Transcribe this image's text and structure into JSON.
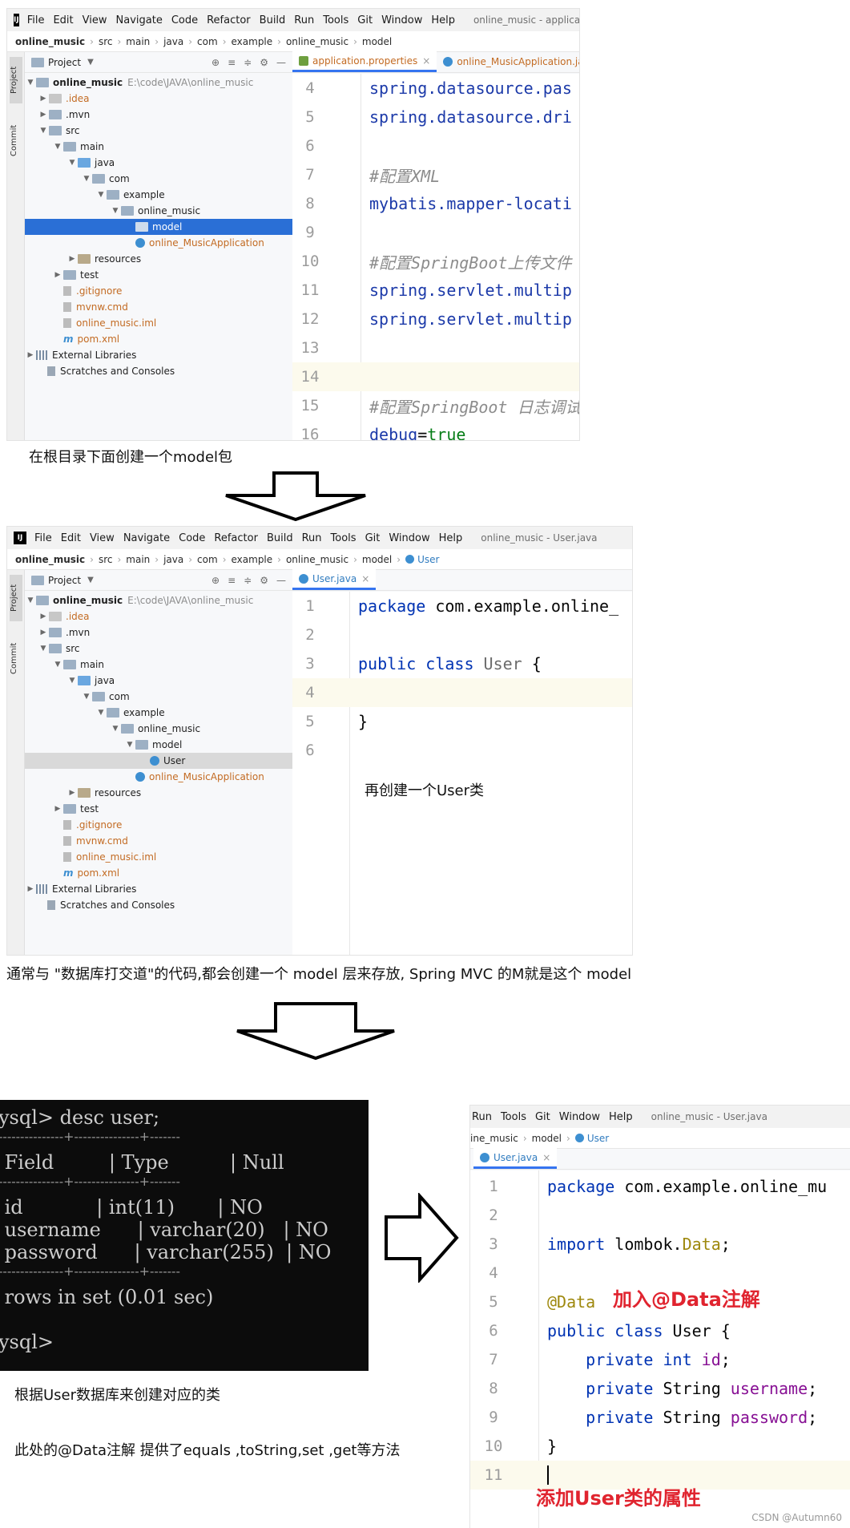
{
  "ide1": {
    "menu": [
      "File",
      "Edit",
      "View",
      "Navigate",
      "Code",
      "Refactor",
      "Build",
      "Run",
      "Tools",
      "Git",
      "Window",
      "Help"
    ],
    "window_title": "online_music - application",
    "breadcrumbs": [
      "online_music",
      "src",
      "main",
      "java",
      "com",
      "example",
      "online_music",
      "model"
    ],
    "side_tabs": [
      "Project",
      "Commit"
    ],
    "project_label": "Project",
    "tree": [
      {
        "label": "online_music",
        "extra": "E:\\code\\JAVA\\online_music"
      },
      {
        "label": ".idea"
      },
      {
        "label": ".mvn"
      },
      {
        "label": "src"
      },
      {
        "label": "main"
      },
      {
        "label": "java"
      },
      {
        "label": "com"
      },
      {
        "label": "example"
      },
      {
        "label": "online_music"
      },
      {
        "label": "model"
      },
      {
        "label": "online_MusicApplication"
      },
      {
        "label": "resources"
      },
      {
        "label": "test"
      },
      {
        "label": ".gitignore"
      },
      {
        "label": "mvnw.cmd"
      },
      {
        "label": "online_music.iml"
      },
      {
        "label": "pom.xml"
      },
      {
        "label": "External Libraries"
      },
      {
        "label": "Scratches and Consoles"
      }
    ],
    "tabs": [
      "application.properties",
      "online_MusicApplication.java"
    ],
    "lines": [
      {
        "n": "4",
        "code": "spring.datasource.pas"
      },
      {
        "n": "5",
        "code": "spring.datasource.dri"
      },
      {
        "n": "6",
        "code": ""
      },
      {
        "n": "7",
        "code": "#配置XML"
      },
      {
        "n": "8",
        "code": "mybatis.mapper-locati"
      },
      {
        "n": "9",
        "code": ""
      },
      {
        "n": "10",
        "code": "#配置SpringBoot上传文件"
      },
      {
        "n": "11",
        "code": "spring.servlet.multip"
      },
      {
        "n": "12",
        "code": "spring.servlet.multip"
      },
      {
        "n": "13",
        "code": ""
      },
      {
        "n": "14",
        "code": ""
      },
      {
        "n": "15",
        "code": "#配置SpringBoot 日志调试"
      },
      {
        "n": "16",
        "code_key": "debug",
        "code_eq": "=",
        "code_val": "true"
      }
    ]
  },
  "caption1": "在根目录下面创建一个model包",
  "ide2": {
    "menu": [
      "File",
      "Edit",
      "View",
      "Navigate",
      "Code",
      "Refactor",
      "Build",
      "Run",
      "Tools",
      "Git",
      "Window",
      "Help"
    ],
    "window_title": "online_music - User.java",
    "breadcrumbs": [
      "online_music",
      "src",
      "main",
      "java",
      "com",
      "example",
      "online_music",
      "model",
      "User"
    ],
    "side_tabs": [
      "Project",
      "Commit"
    ],
    "project_label": "Project",
    "tree": [
      {
        "label": "online_music",
        "extra": "E:\\code\\JAVA\\online_music"
      },
      {
        "label": ".idea"
      },
      {
        "label": ".mvn"
      },
      {
        "label": "src"
      },
      {
        "label": "main"
      },
      {
        "label": "java"
      },
      {
        "label": "com"
      },
      {
        "label": "example"
      },
      {
        "label": "online_music"
      },
      {
        "label": "model"
      },
      {
        "label": "User"
      },
      {
        "label": "online_MusicApplication"
      },
      {
        "label": "resources"
      },
      {
        "label": "test"
      },
      {
        "label": ".gitignore"
      },
      {
        "label": "mvnw.cmd"
      },
      {
        "label": "online_music.iml"
      },
      {
        "label": "pom.xml"
      },
      {
        "label": "External Libraries"
      },
      {
        "label": "Scratches and Consoles"
      }
    ],
    "tabs": [
      "User.java"
    ],
    "lines": [
      {
        "n": "1",
        "kw": "package",
        "rest": " com.example.online_"
      },
      {
        "n": "2"
      },
      {
        "n": "3",
        "kw": "public class",
        "cls": " User",
        "rest": " {"
      },
      {
        "n": "4"
      },
      {
        "n": "5",
        "rest": "}"
      },
      {
        "n": "6"
      }
    ],
    "note": "再创建一个User类"
  },
  "caption2": "通常与 \"数据库打交道\"的代码,都会创建一个 model 层来存放, Spring MVC 的M就是这个 model",
  "terminal": {
    "lines": [
      "ysql> desc user;",
      "---------------+---------------+-------",
      " Field         | Type          | Null",
      "---------------+---------------+-------",
      " id            | int(11)       | NO",
      " username      | varchar(20)   | NO",
      " password      | varchar(255)  | NO",
      "---------------+---------------+-------",
      " rows in set (0.01 sec)",
      "",
      "ysql>"
    ]
  },
  "caption3": "根据User数据库来创建对应的类",
  "caption4": "此处的@Data注解 提供了equals ,toString,set ,get等方法",
  "ide3": {
    "menu": [
      "Run",
      "Tools",
      "Git",
      "Window",
      "Help"
    ],
    "window_title": "online_music - User.java",
    "breadcrumbs": [
      "ine_music",
      "model",
      "User"
    ],
    "tabs": [
      "User.java"
    ],
    "lines": [
      {
        "n": "1",
        "kw": "package",
        "rest": " com.example.online_mu"
      },
      {
        "n": "2"
      },
      {
        "n": "3",
        "kw": "import",
        "rest": " lombok.",
        "ann": "Data",
        "rest2": ";"
      },
      {
        "n": "4"
      },
      {
        "n": "5",
        "ann": "@Data"
      },
      {
        "n": "6",
        "kw": "public class",
        "rest": " User {"
      },
      {
        "n": "7",
        "kw": "    private int",
        "rest": " ",
        "purple": "id",
        "rest2": ";"
      },
      {
        "n": "8",
        "kw": "    private",
        "rest": " String ",
        "purple": "username",
        "rest2": ";"
      },
      {
        "n": "9",
        "kw": "    private",
        "rest": " String ",
        "purple": "password",
        "rest2": ";"
      },
      {
        "n": "10",
        "rest": "}"
      },
      {
        "n": "11"
      }
    ],
    "note_data": "加入@Data注解",
    "note_attr": "添加User类的属性"
  },
  "watermark": "CSDN @Autumn60",
  "colors": {
    "accent": "#2a6fd6",
    "note_red": "#e0242f",
    "terminal_bg": "#0c0c0c"
  }
}
